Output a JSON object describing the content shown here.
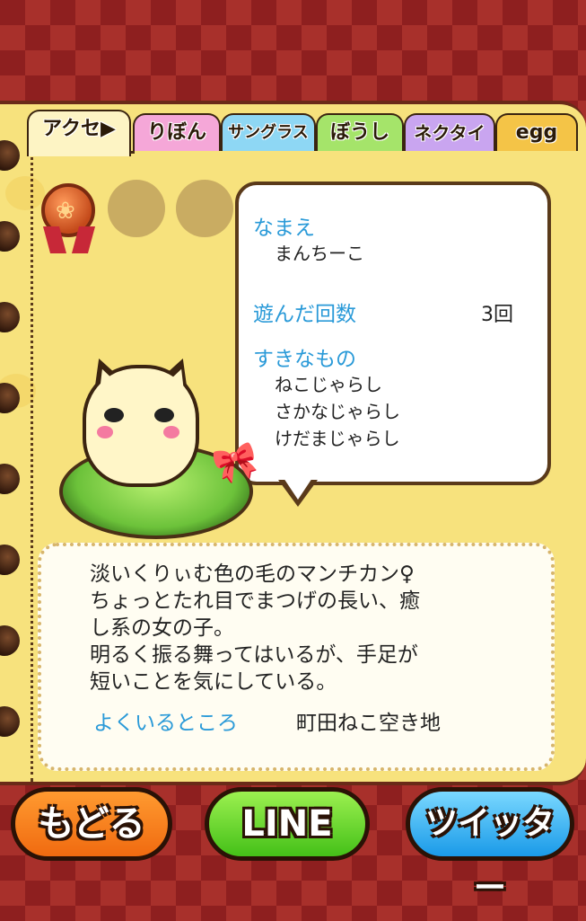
{
  "tabs": [
    {
      "label": "アクセ",
      "color": "#fdf4c4"
    },
    {
      "label": "りぼん",
      "color": "#f5a7d8"
    },
    {
      "label": "サングラス",
      "color": "#8ed7f4"
    },
    {
      "label": "ぼうし",
      "color": "#a5e46a"
    },
    {
      "label": "ネクタイ",
      "color": "#c9a5f0"
    },
    {
      "label": "egg",
      "color": "#f4c447"
    }
  ],
  "profile": {
    "name_label": "なまえ",
    "name_value": "まんちーこ",
    "plays_label": "遊んだ回数",
    "plays_value": "3回",
    "likes_label": "すきなもの",
    "likes": [
      "ねこじゃらし",
      "さかなじゃらし",
      "けだまじゃらし"
    ]
  },
  "description": {
    "text": "淡いくりぃむ色の毛のマンチカン♀\nちょっとたれ目でまつげの長い、癒\nし系の女の子。\n明るく振る舞ってはいるが、手足が\n短いことを気にしている。",
    "location_label": "よくいるところ",
    "location_value": "町田ねこ空き地"
  },
  "buttons": {
    "back": "もどる",
    "line": "LINE",
    "twitter": "ツイッター"
  },
  "icons": {
    "tab_arrow": "▶",
    "badge": "paw-medal-icon",
    "paw_glyph": "❀",
    "bow_glyph": "🎀"
  }
}
